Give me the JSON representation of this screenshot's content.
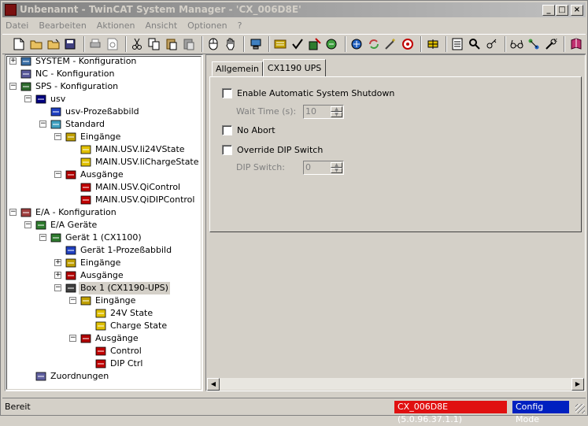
{
  "window": {
    "title": "Unbenannt - TwinCAT System Manager - 'CX_006D8E'",
    "minimize": "_",
    "maximize": "□",
    "close": "×"
  },
  "menu": [
    "Datei",
    "Bearbeiten",
    "Aktionen",
    "Ansicht",
    "Optionen",
    "?"
  ],
  "tree": {
    "nodes": [
      {
        "label": "SYSTEM - Konfiguration",
        "expander": "+",
        "icon": "system-icon",
        "iconColor": "#3a6ea5"
      },
      {
        "label": "NC - Konfiguration",
        "expander": "",
        "icon": "nc-icon",
        "iconColor": "#5a5a9a"
      },
      {
        "label": "SPS - Konfiguration",
        "expander": "-",
        "icon": "sps-icon",
        "iconColor": "#2e6b2e"
      },
      {
        "label": "usv",
        "expander": "-",
        "icon": "iec-icon",
        "iconColor": "#000080"
      },
      {
        "label": "usv-Prozeßabbild",
        "expander": "",
        "icon": "process-image-icon",
        "iconColor": "#2040c0"
      },
      {
        "label": "Standard",
        "expander": "-",
        "icon": "task-icon",
        "iconColor": "#40a0c0"
      },
      {
        "label": "Eingänge",
        "expander": "-",
        "icon": "inputs-icon",
        "iconColor": "#c0a000"
      },
      {
        "label": "MAIN.USV.Ii24VState",
        "expander": "",
        "icon": "input-var-icon",
        "iconColor": "#e0c000"
      },
      {
        "label": "MAIN.USV.IiChargeState",
        "expander": "",
        "icon": "input-var-icon",
        "iconColor": "#e0c000"
      },
      {
        "label": "Ausgänge",
        "expander": "-",
        "icon": "outputs-icon",
        "iconColor": "#b00000"
      },
      {
        "label": "MAIN.USV.QiControl",
        "expander": "",
        "icon": "output-var-icon",
        "iconColor": "#c00000"
      },
      {
        "label": "MAIN.USV.QiDIPControl",
        "expander": "",
        "icon": "output-var-icon",
        "iconColor": "#c00000"
      },
      {
        "label": "E/A - Konfiguration",
        "expander": "-",
        "icon": "io-config-icon",
        "iconColor": "#a04040"
      },
      {
        "label": "E/A Geräte",
        "expander": "-",
        "icon": "io-devices-icon",
        "iconColor": "#2e7b2e"
      },
      {
        "label": "Gerät 1 (CX1100)",
        "expander": "-",
        "icon": "device-icon",
        "iconColor": "#2e7b2e"
      },
      {
        "label": "Gerät 1-Prozeßabbild",
        "expander": "",
        "icon": "process-image-icon",
        "iconColor": "#2040c0"
      },
      {
        "label": "Eingänge",
        "expander": "+",
        "icon": "inputs-icon",
        "iconColor": "#c0a000"
      },
      {
        "label": "Ausgänge",
        "expander": "+",
        "icon": "outputs-icon",
        "iconColor": "#b00000"
      },
      {
        "label": "Box 1 (CX1190-UPS)",
        "expander": "-",
        "icon": "box-icon",
        "iconColor": "#404040"
      },
      {
        "label": "Eingänge",
        "expander": "-",
        "icon": "inputs-icon",
        "iconColor": "#c0a000"
      },
      {
        "label": "24V State",
        "expander": "",
        "icon": "input-var-icon",
        "iconColor": "#e0c000"
      },
      {
        "label": "Charge State",
        "expander": "",
        "icon": "input-var-icon",
        "iconColor": "#e0c000"
      },
      {
        "label": "Ausgänge",
        "expander": "-",
        "icon": "outputs-icon",
        "iconColor": "#b00000"
      },
      {
        "label": "Control",
        "expander": "",
        "icon": "output-var-icon",
        "iconColor": "#c00000"
      },
      {
        "label": "DIP Ctrl",
        "expander": "",
        "icon": "output-var-icon",
        "iconColor": "#c00000"
      },
      {
        "label": "Zuordnungen",
        "expander": "",
        "icon": "mappings-icon",
        "iconColor": "#6060a0"
      }
    ]
  },
  "tabs": {
    "general": "Allgemein",
    "ups": "CX1190 UPS"
  },
  "form": {
    "enable_shutdown": "Enable Automatic System Shutdown",
    "wait_time_label": "Wait Time (s):",
    "wait_time_value": "10",
    "no_abort": "No Abort",
    "override_dip": "Override DIP Switch",
    "dip_switch_label": "DIP Switch:",
    "dip_switch_value": "0"
  },
  "status": {
    "text": "Bereit",
    "target": "CX_006D8E (5.0.96.37.1.1)",
    "target_color": "#e01010",
    "mode": "Config Mode",
    "mode_color": "#0020c0"
  }
}
